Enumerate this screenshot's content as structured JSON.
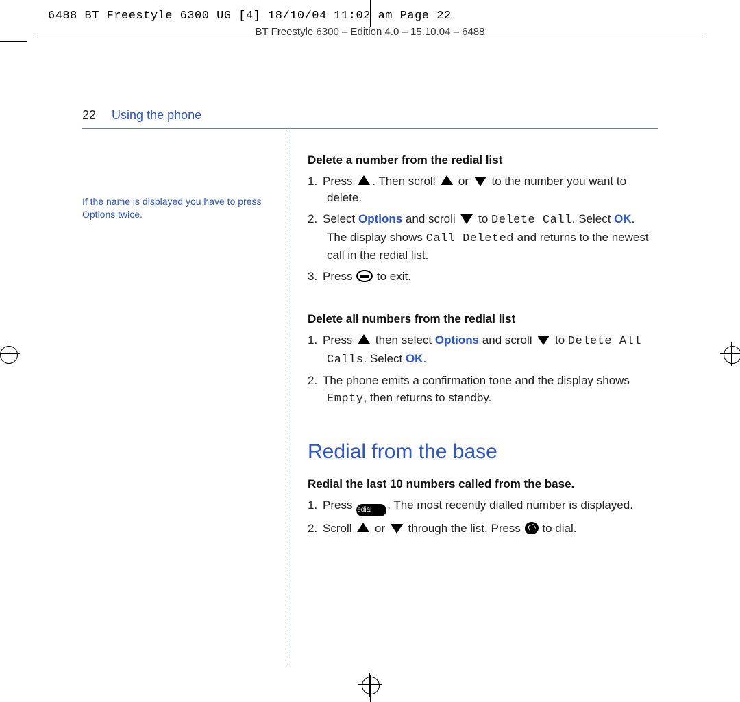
{
  "slug": "6488 BT Freestyle 6300 UG [4]  18/10/04  11:02 am  Page 22",
  "edition": "BT Freestyle 6300 – Edition 4.0 – 15.10.04 – 6488",
  "page_number": "22",
  "running_head": "Using the phone",
  "side_note": "If the name is displayed you have to press Options twice.",
  "colors": {
    "blue": "#2a55d4"
  },
  "sections": {
    "sec1": {
      "heading": "Delete a number from the redial list",
      "steps": {
        "s1a": "Press ",
        "s1b": ". Then scroll ",
        "s1c": " or ",
        "s1d": " to the number you want to delete.",
        "s2a": "Select ",
        "s2opt": "Options",
        "s2b": " and scroll ",
        "s2c": " to ",
        "s2lcd1": "Delete Call",
        "s2d": ". Select ",
        "s2ok": "OK",
        "s2e": ". The display shows ",
        "s2lcd2": "Call Deleted",
        "s2f": " and returns to the newest call in the redial list.",
        "s3a": "Press ",
        "s3b": " to exit."
      }
    },
    "sec2": {
      "heading": "Delete all numbers from the redial list",
      "steps": {
        "s1a": "Press ",
        "s1b": " then select ",
        "s1opt": "Options",
        "s1c": " and scroll ",
        "s1d": " to ",
        "s1lcd1": "Delete All Calls",
        "s1e": ". Select ",
        "s1ok": "OK",
        "s1f": ".",
        "s2a": "The phone emits a confirmation tone and the display shows ",
        "s2lcd1": "Empty",
        "s2b": ", then returns to standby."
      }
    },
    "big_heading": "Redial from the base",
    "sec3": {
      "heading": "Redial the last 10 numbers called from the base.",
      "pill_label": "Redial",
      "steps": {
        "s1a": "Press ",
        "s1b": ". The most recently dialled number is displayed.",
        "s2a": "Scroll ",
        "s2b": " or ",
        "s2c": " through the list. Press ",
        "s2d": " to dial."
      }
    }
  },
  "nums": {
    "n1": "1.",
    "n2": "2.",
    "n3": "3."
  }
}
